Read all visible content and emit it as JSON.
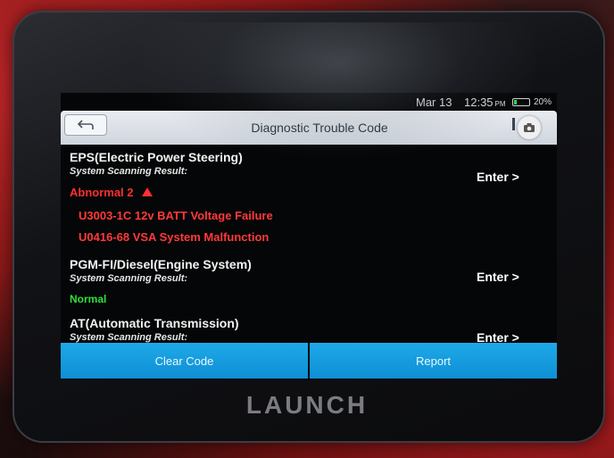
{
  "status": {
    "date": "Mar 13",
    "time": "12:35",
    "ampm": "PM",
    "battery_pct": "20%",
    "battery_level": 0.2
  },
  "header": {
    "title": "Diagnostic Trouble Code"
  },
  "systems": [
    {
      "name": "EPS(Electric Power Steering)",
      "sub": "System Scanning Result:",
      "result": "Abnormal 2",
      "enter": "Enter >",
      "codes": [
        "U3003-1C 12v BATT Voltage Failure",
        "U0416-68 VSA System Malfunction"
      ]
    },
    {
      "name": "PGM-FI/Diesel(Engine System)",
      "sub": "System Scanning Result:",
      "result": "Normal",
      "enter": "Enter >"
    },
    {
      "name": "AT(Automatic Transmission)",
      "sub": "System Scanning Result:",
      "enter": "Enter >"
    }
  ],
  "actions": {
    "clear": "Clear Code",
    "report": "Report"
  },
  "brand": "LAUNCH",
  "colors": {
    "accent": "#1ea9e8",
    "error": "#ff3030",
    "ok": "#2ee03a",
    "battery": "#2ee04a"
  }
}
